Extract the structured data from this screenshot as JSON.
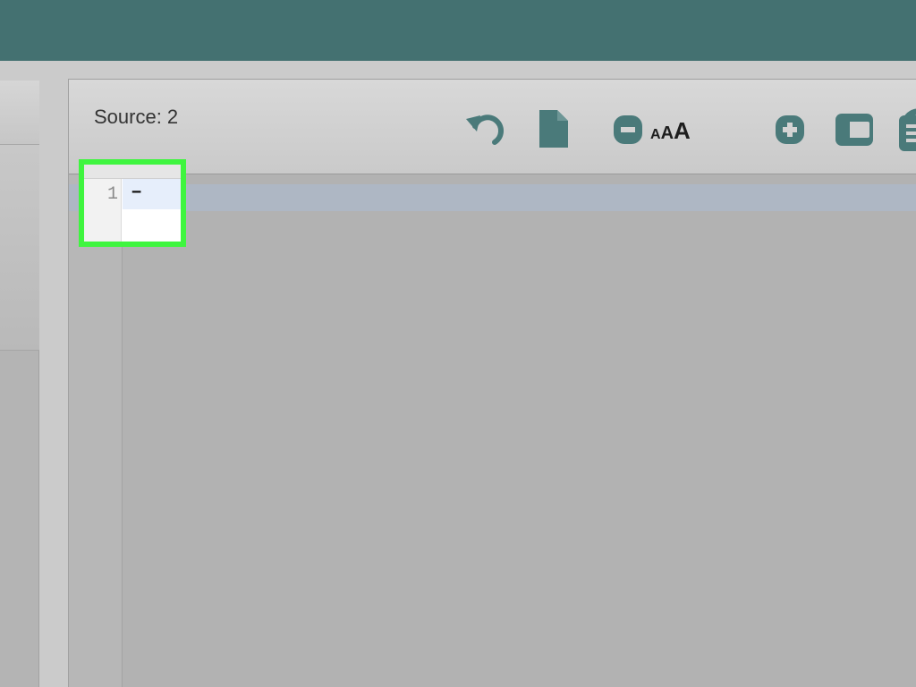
{
  "header": {
    "source_label": "Source: 2"
  },
  "toolbar": {
    "icons": [
      "undo-icon",
      "new-file-icon",
      "decrease-font-icon",
      "font-size-icon",
      "increase-font-icon",
      "wrap-icon",
      "refresh-icon",
      "list-icon"
    ],
    "font_size_glyph_small": "A",
    "font_size_glyph_medium": "A",
    "font_size_glyph_large": "A"
  },
  "editor": {
    "lines": [
      {
        "number": "1",
        "text": "–"
      }
    ]
  },
  "colors": {
    "top_bar": "#447171",
    "icon": "#4a7a7a",
    "highlight": "#3ff53f",
    "active_line": "#e6eefb"
  }
}
